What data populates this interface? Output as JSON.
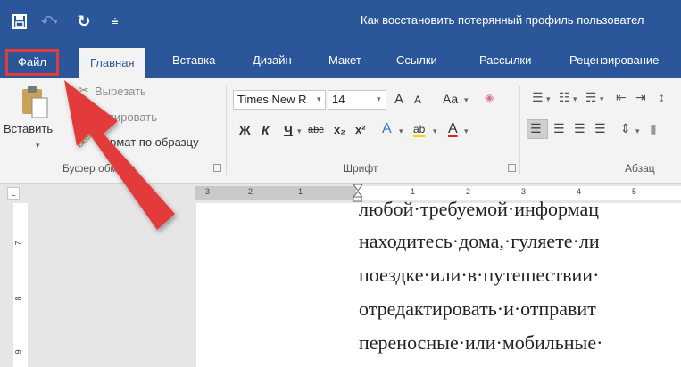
{
  "window": {
    "title": "Как восстановить потерянный профиль пользовател",
    "quick_access": {
      "undo_icon": "undo-icon",
      "redo_icon": "redo-icon",
      "save_icon": "save-icon",
      "customize_icon": "customize-icon"
    }
  },
  "tabs": {
    "file": "Файл",
    "items": [
      "Главная",
      "Вставка",
      "Дизайн",
      "Макет",
      "Ссылки",
      "Рассылки",
      "Рецензирование"
    ],
    "active": "Главная"
  },
  "clipboard": {
    "paste": "Вставить",
    "cut": "Вырезать",
    "copy": "Копировать",
    "format_painter": "Формат по образцу",
    "group_label": "Буфер обмена"
  },
  "font": {
    "font_name": "Times New R",
    "font_size": "14",
    "grow": "A",
    "shrink": "A",
    "case": "Aa",
    "bold": "Ж",
    "italic": "К",
    "underline": "Ч",
    "strike": "abc",
    "subscript": "x₂",
    "superscript": "x²",
    "text_effects": "A",
    "highlight": "ab",
    "font_color": "A",
    "group_label": "Шрифт"
  },
  "paragraph": {
    "group_label": "Абзац"
  },
  "ruler": {
    "numbers": [
      "3",
      "2",
      "1",
      "1",
      "2",
      "3",
      "4",
      "5"
    ],
    "vertical_numbers": [
      "7",
      "8",
      "9"
    ]
  },
  "document": {
    "lines": [
      "любой·требуемой·информац",
      "находитесь·дома,·гуляете·ли",
      "поездке·или·в·путешествии·",
      "отредактировать·и·отправит",
      "переносные·или·мобильные·"
    ]
  },
  "colors": {
    "ribbon_blue": "#2b579a",
    "highlight_red": "#e33b3b"
  }
}
